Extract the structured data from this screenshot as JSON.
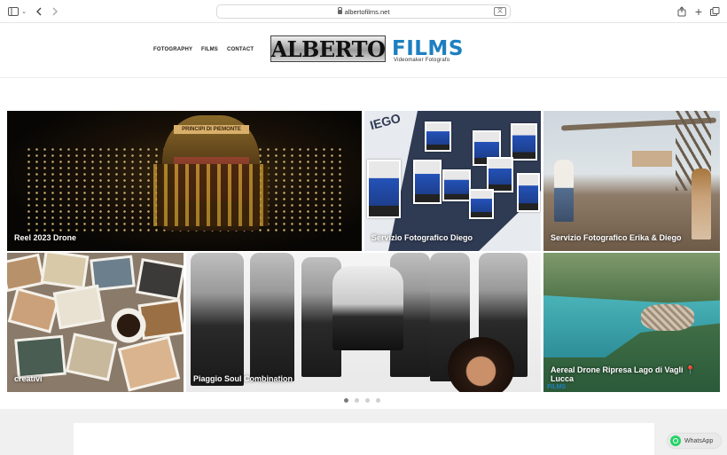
{
  "browser": {
    "url": "albertofilms.net"
  },
  "nav": {
    "items": [
      "FOTOGRAPHY",
      "FILMS",
      "CONTACT"
    ]
  },
  "logo": {
    "name": "ALBERTO",
    "films": "FILMS",
    "tagline": "Videomaker  Fotografo"
  },
  "gallery": {
    "tiles": [
      {
        "caption": "Reel 2023 Drone",
        "banner": "PRINCIPI DI PIEMONTE"
      },
      {
        "caption": "Servizio Fotografico Diego",
        "overlay": "IEGO"
      },
      {
        "caption": "Servizio Fotografico Erika & Diego"
      },
      {
        "caption": "creativi"
      },
      {
        "caption": "Piaggio Soul Combination"
      },
      {
        "caption": "Aereal Drone Ripresa Lago di Vagli 📍 Lucca",
        "watermark": "FILMS"
      }
    ],
    "dots": {
      "count": 4,
      "active": 0
    }
  },
  "whatsapp": {
    "label": "WhatsApp"
  },
  "colors": {
    "brand_blue": "#1d7fc1",
    "whatsapp_green": "#25d366"
  }
}
